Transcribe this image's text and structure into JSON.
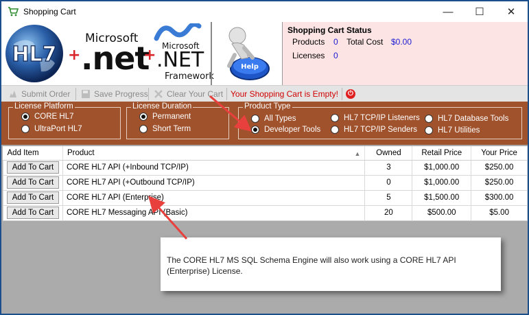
{
  "window": {
    "title": "Shopping Cart",
    "min_glyph": "—",
    "max_glyph": "☐",
    "close_glyph": "✕"
  },
  "banner": {
    "logo_text": "HL7",
    "plus": "+",
    "ms_label_1": "Microsoft",
    "dotnet_label": ".net",
    "ms_label_2": "Microsoft",
    "net_label": ".NET",
    "framework_label": "Framework",
    "help_label": "Help"
  },
  "status": {
    "heading": "Shopping Cart Status",
    "products_label": "Products",
    "products_value": "0",
    "total_cost_label": "Total Cost",
    "total_cost_value": "$0.00",
    "licenses_label": "Licenses",
    "licenses_value": "0"
  },
  "toolbar": {
    "submit_label": "Submit Order",
    "save_label": "Save Progress",
    "clear_label": "Clear Your Cart",
    "empty_message": "Your Shopping Cart is Empty!",
    "power_glyph": "⏻"
  },
  "filters": {
    "license_platform": {
      "legend": "License Platform",
      "options": [
        "CORE HL7",
        "UltraPort HL7"
      ],
      "selected": "CORE HL7"
    },
    "license_duration": {
      "legend": "License Duration",
      "options": [
        "Permanent",
        "Short Term"
      ],
      "selected": "Permanent"
    },
    "product_type": {
      "legend": "Product Type",
      "options": [
        "All Types",
        "Developer Tools",
        "HL7 TCP/IP Listeners",
        "HL7 TCP/IP Senders",
        "HL7 Database Tools",
        "HL7 Utilities"
      ],
      "selected": "Developer Tools"
    }
  },
  "grid": {
    "columns": [
      "Add Item",
      "Product",
      "Owned",
      "Retail Price",
      "Your Price"
    ],
    "add_button_label": "Add To Cart",
    "rows": [
      {
        "product": "CORE HL7 API (+Inbound TCP/IP)",
        "owned": "3",
        "retail": "$1,000.00",
        "yours": "$250.00"
      },
      {
        "product": "CORE HL7 API (+Outbound TCP/IP)",
        "owned": "0",
        "retail": "$1,000.00",
        "yours": "$250.00"
      },
      {
        "product": "CORE HL7 API (Enterprise)",
        "owned": "5",
        "retail": "$1,500.00",
        "yours": "$300.00"
      },
      {
        "product": "CORE HL7 Messaging API (Basic)",
        "owned": "20",
        "retail": "$500.00",
        "yours": "$5.00"
      }
    ]
  },
  "callout": {
    "text": "The CORE HL7 MS SQL Schema Engine will also work using a CORE HL7 API (Enterprise) License."
  },
  "colors": {
    "filter_panel": "#a0522d",
    "status_panel": "#fce4e4",
    "accent_blue": "#1a1ad0",
    "warning_red": "#d00000",
    "annotation_red": "#e8403c"
  }
}
